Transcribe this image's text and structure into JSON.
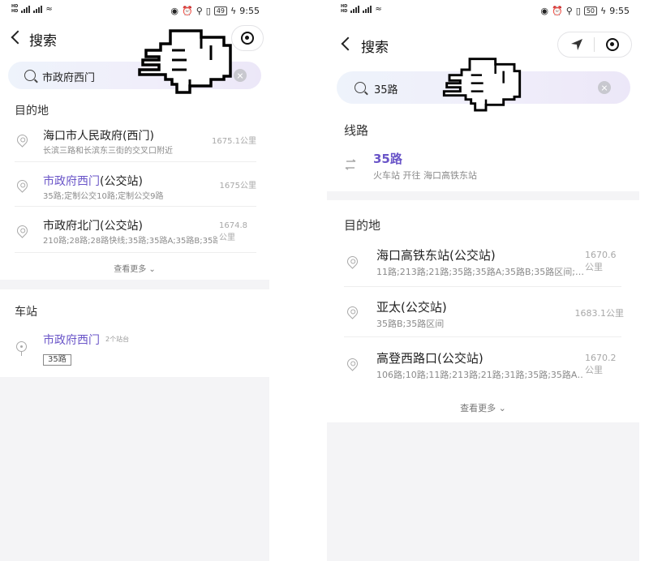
{
  "left": {
    "status": {
      "time": "9:55",
      "battery": "49"
    },
    "header": {
      "title": "搜索"
    },
    "search": {
      "query": "市政府西门"
    },
    "destinations": {
      "title": "目的地",
      "items": [
        {
          "name_hl": "",
          "name_rest": "海口市人民政府(西门)",
          "sub": "长滨三路和长滨东三街的交叉口附近",
          "dist": "1675.1公里"
        },
        {
          "name_hl": "市政府西门",
          "name_rest": "(公交站)",
          "sub": "35路;定制公交10路;定制公交9路",
          "dist": "1675公里"
        },
        {
          "name_hl": "",
          "name_rest": "市政府北门(公交站)",
          "sub": "210路;28路;28路快线;35路;35路A;35路B;35路…",
          "dist1": "1674.8",
          "dist2": "公里"
        }
      ],
      "more": "查看更多 ⌄"
    },
    "stations": {
      "title": "车站",
      "item": {
        "name": "市政府西门",
        "count": "2个站台",
        "tag": "35路"
      }
    }
  },
  "right": {
    "status": {
      "time": "9:55",
      "battery": "50"
    },
    "header": {
      "title": "搜索"
    },
    "search": {
      "query": "35路"
    },
    "routes": {
      "title": "线路",
      "item": {
        "name": "35路",
        "sub": "火车站 开往 海口高铁东站"
      }
    },
    "destinations": {
      "title": "目的地",
      "items": [
        {
          "name": "海口高铁东站(公交站)",
          "sub": "11路;213路;21路;35路;35路A;35路B;35路区间;…",
          "dist1": "1670.6",
          "dist2": "公里"
        },
        {
          "name": "亚太(公交站)",
          "sub": "35路B;35路区间",
          "dist1": "1683.1公里",
          "dist2": ""
        },
        {
          "name": "高登西路口(公交站)",
          "sub": "106路;10路;11路;213路;21路;31路;35路;35路A…",
          "dist1": "1670.2",
          "dist2": "公里"
        }
      ],
      "more": "查看更多 ⌄"
    }
  }
}
